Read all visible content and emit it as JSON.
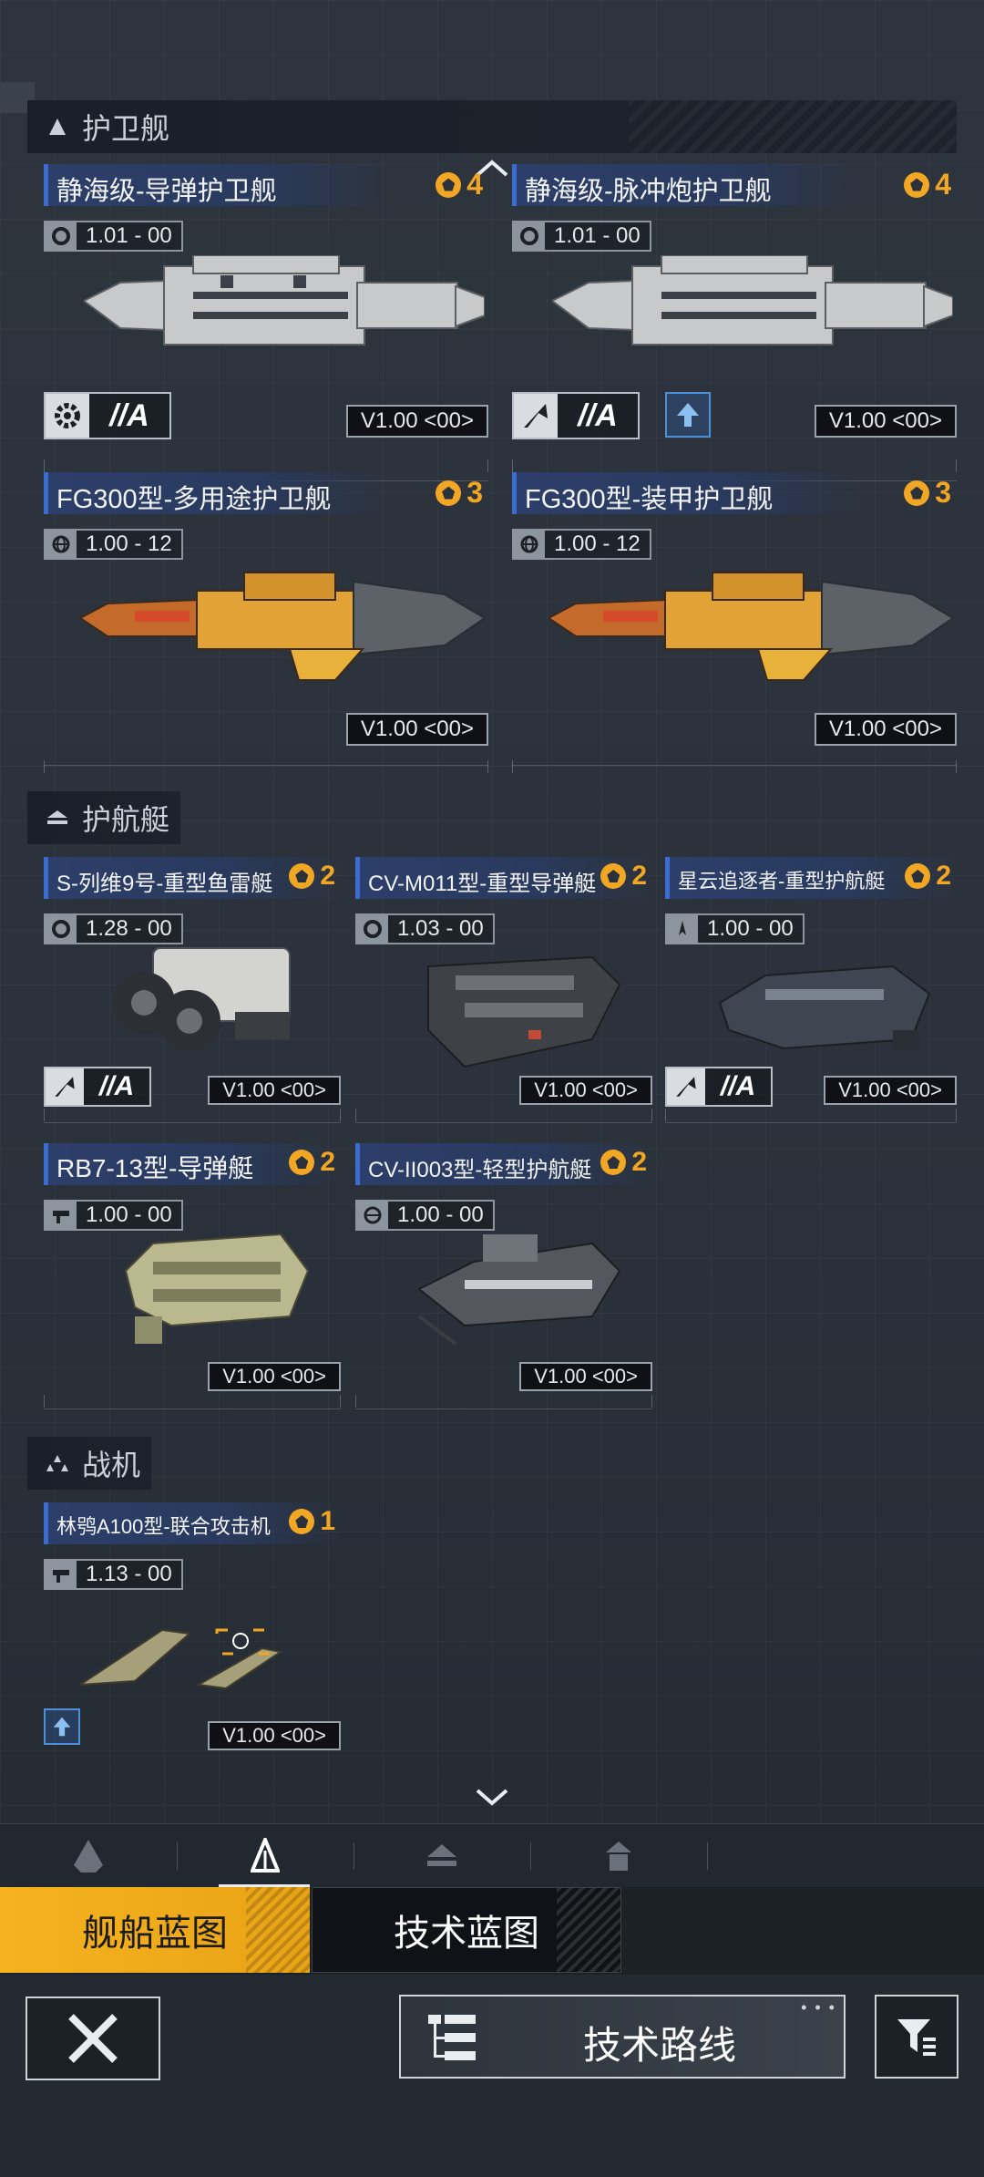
{
  "sections": {
    "frigate": {
      "title": "护卫舰"
    },
    "corvette": {
      "title": "护航艇"
    },
    "fighter": {
      "title": "战机"
    }
  },
  "frigates": [
    {
      "name": "静海级-导弹护卫舰",
      "rank": "4",
      "version": "1.01 - 00",
      "trait": "//A",
      "vbox": "V1.00  <00>"
    },
    {
      "name": "静海级-脉冲炮护卫舰",
      "rank": "4",
      "version": "1.01 - 00",
      "trait": "//A",
      "vbox": "V1.00  <00>"
    },
    {
      "name": "FG300型-多用途护卫舰",
      "rank": "3",
      "version": "1.00 - 12",
      "vbox": "V1.00  <00>"
    },
    {
      "name": "FG300型-装甲护卫舰",
      "rank": "3",
      "version": "1.00 - 12",
      "vbox": "V1.00  <00>"
    }
  ],
  "corvettes": [
    {
      "name": "S-列维9号-重型鱼雷艇",
      "rank": "2",
      "version": "1.28 - 00",
      "trait": "//A",
      "vbox": "V1.00  <00>"
    },
    {
      "name": "CV-M011型-重型导弹艇",
      "rank": "2",
      "version": "1.03 - 00",
      "vbox": "V1.00  <00>"
    },
    {
      "name": "星云追逐者-重型护航艇",
      "rank": "2",
      "version": "1.00 - 00",
      "trait": "//A",
      "vbox": "V1.00  <00>"
    },
    {
      "name": "RB7-13型-导弹艇",
      "rank": "2",
      "version": "1.00 - 00",
      "vbox": "V1.00  <00>"
    },
    {
      "name": "CV-II003型-轻型护航艇",
      "rank": "2",
      "version": "1.00 - 00",
      "vbox": "V1.00  <00>"
    }
  ],
  "fighters": [
    {
      "name": "林鸮A100型-联合攻击机",
      "rank": "1",
      "version": "1.13 - 00",
      "vbox": "V1.00  <00>"
    }
  ],
  "blueprint_tabs": {
    "ship": "舰船蓝图",
    "tech": "技术蓝图"
  },
  "footer": {
    "route": "技术路线"
  },
  "colors": {
    "accent": "#f2a724",
    "title_bar": "#2c3f6a",
    "boost": "#4f8fd6"
  }
}
